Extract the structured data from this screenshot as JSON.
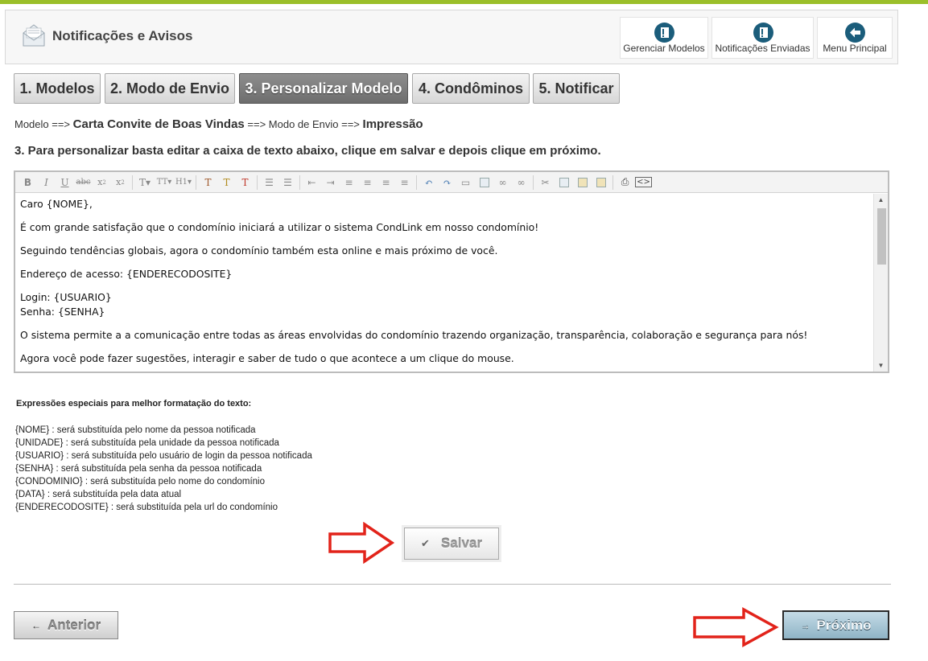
{
  "header": {
    "title": "Notificações e Avisos",
    "icon": "envelope-icon",
    "nav": [
      {
        "label": "Gerenciar Modelos",
        "icon": "book-icon"
      },
      {
        "label": "Notificações Enviadas",
        "icon": "book-icon"
      },
      {
        "label": "Menu Principal",
        "icon": "arrow-left-icon"
      }
    ]
  },
  "tabs": [
    {
      "label": "1. Modelos",
      "active": false
    },
    {
      "label": "2. Modo de Envio",
      "active": false
    },
    {
      "label": "3. Personalizar Modelo",
      "active": true
    },
    {
      "label": "4. Condôminos",
      "active": false
    },
    {
      "label": "5. Notificar",
      "active": false
    }
  ],
  "breadcrumb": {
    "modelo_label": "Modelo ==>",
    "modelo_value": "Carta Convite de Boas Vindas",
    "modo_label": "==> Modo de Envio ==>",
    "modo_value": "Impressão"
  },
  "instruction": "3. Para personalizar basta editar a caixa de texto abaixo, clique em salvar e depois clique em próximo.",
  "editor": {
    "paragraphs": [
      "Caro {NOME},",
      "É com grande satisfação que o condomínio iniciará a utilizar o sistema CondLink em nosso condomínio!",
      "Seguindo tendências globais, agora o condomínio também esta online e mais próximo de você.",
      "Endereço de acesso: {ENDERECODOSITE}",
      "Login: {USUARIO}",
      "Senha: {SENHA}",
      "O sistema permite a a comunicação entre todas as áreas envolvidas do condomínio trazendo organização, transparência,  colaboração e segurança para nós!",
      "Agora você pode fazer sugestões, interagir e saber de tudo o que acontece a um clique do mouse."
    ]
  },
  "expressions": {
    "title": "Expressões especiais para melhor formatação do texto:",
    "items": [
      "{NOME} : será substituída pelo nome da pessoa notificada",
      "{UNIDADE} : será substituída pela unidade da pessoa notificada",
      "{USUARIO} : será substituída pelo usuário de login da pessoa notificada",
      "{SENHA} : será substituída pela senha da pessoa notificada",
      "{CONDOMINIO} : será substituída pelo nome do condomínio",
      "{DATA} : será substituída pela data atual",
      "{ENDERECODOSITE} : será substituída pela url do condomínio"
    ]
  },
  "buttons": {
    "save": "Salvar",
    "prev": "Anterior",
    "next": "Próximo"
  },
  "colors": {
    "accent_top": "#9bbf2a",
    "nav_icon": "#1b5d7b",
    "arrow_red": "#e2231a",
    "next_button": "#a9c9d8"
  }
}
